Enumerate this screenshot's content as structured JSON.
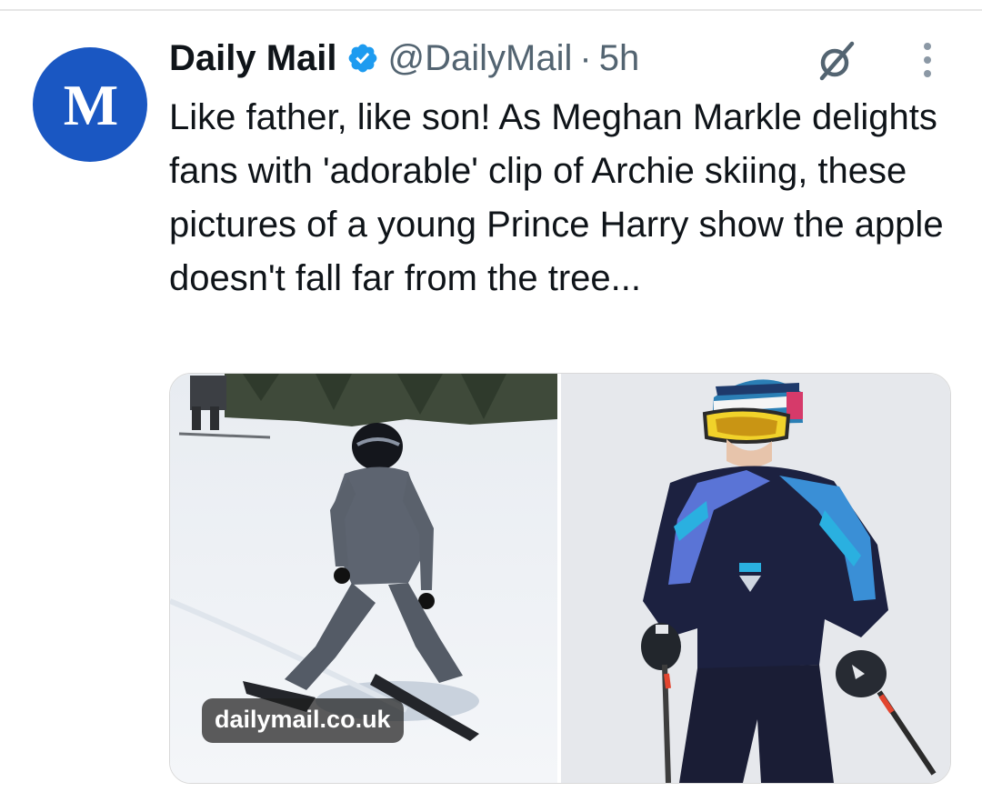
{
  "tweet": {
    "author": {
      "name": "Daily Mail",
      "handle": "@DailyMail",
      "separator": "·",
      "time": "5h",
      "avatar_text": "M",
      "verified": true
    },
    "text": "Like father, like son! As Meghan Markle delights fans with 'adorable' clip of Archie skiing, these pictures of a young Prince Harry show the apple doesn't fall far from the tree...",
    "media": {
      "link_badge": "dailymail.co.uk",
      "images": [
        {
          "subject": "child skiing in grey snowsuit and black helmet"
        },
        {
          "subject": "young skier in navy and blue ski jacket with yellow goggles and striped hat"
        }
      ]
    },
    "icons": {
      "verified": "verified-badge-icon",
      "grok": "grok-icon",
      "more": "more-options-icon"
    }
  },
  "colors": {
    "avatar_bg": "#1a57c2",
    "verified_blue": "#1d9bf0",
    "secondary_text": "#536471",
    "primary_text": "#0f1419"
  }
}
